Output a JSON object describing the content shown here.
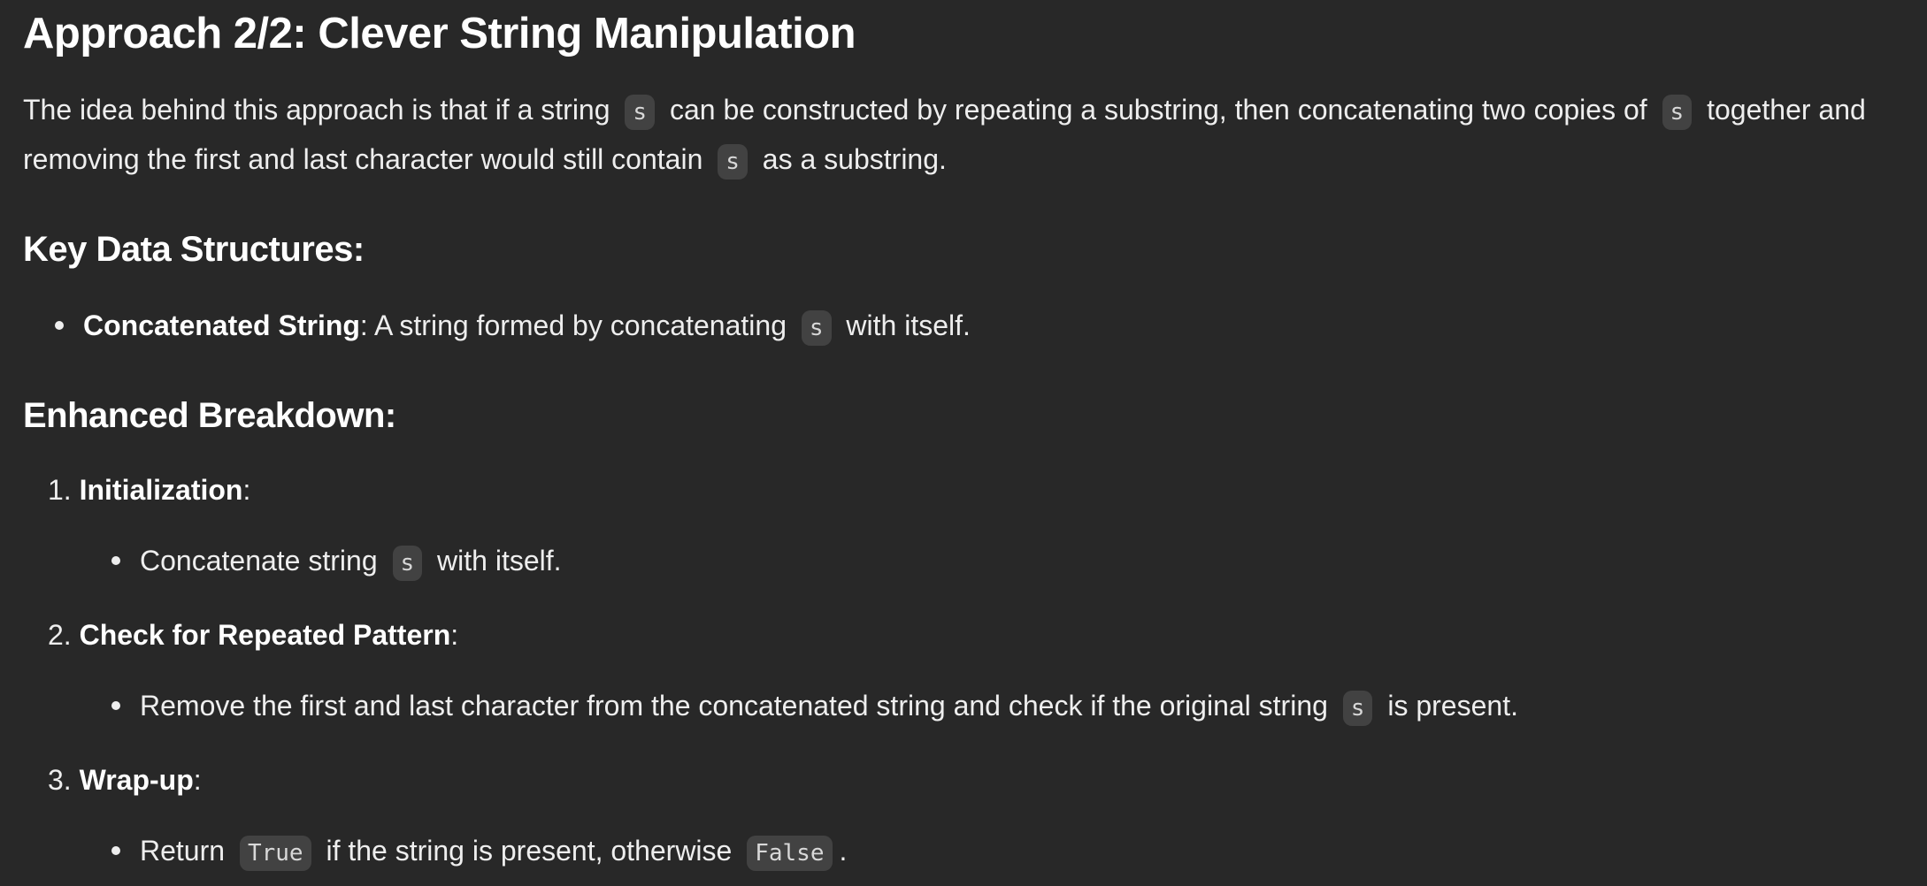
{
  "title": "Approach 2/2: Clever String Manipulation",
  "intro": {
    "t1": "The idea behind this approach is that if a string",
    "c1": "s",
    "t2": "can be constructed by repeating a substring, then concatenating two copies of",
    "c2": "s",
    "t3": "together and removing the first and last character would still contain",
    "c3": "s",
    "t4": "as a substring."
  },
  "key_ds": {
    "heading": "Key Data Structures:",
    "item": {
      "label": "Concatenated String",
      "t1": ": A string formed by concatenating",
      "code": "s",
      "t2": "with itself."
    }
  },
  "breakdown": {
    "heading": "Enhanced Breakdown:",
    "steps": [
      {
        "num": "1.",
        "label": "Initialization",
        "suffix": ":",
        "detail": {
          "t1": "Concatenate string",
          "code": "s",
          "t2": "with itself."
        }
      },
      {
        "num": "2.",
        "label": "Check for Repeated Pattern",
        "suffix": ":",
        "detail": {
          "t1": "Remove the first and last character from the concatenated string and check if the original string",
          "code": "s",
          "t2": "is present."
        }
      },
      {
        "num": "3.",
        "label": "Wrap-up",
        "suffix": ":",
        "detail": {
          "t1": "Return",
          "code1": "True",
          "t2": "if the string is present, otherwise",
          "code2": "False",
          "t3": "."
        }
      }
    ]
  }
}
